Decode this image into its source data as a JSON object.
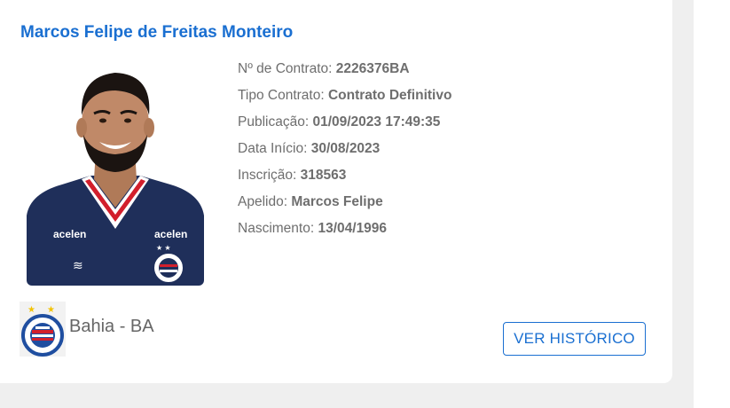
{
  "player": {
    "name": "Marcos Felipe de Freitas Monteiro",
    "photo": {
      "jersey_text_left": "acelen",
      "jersey_text_right": "acelen"
    }
  },
  "details": [
    {
      "label": "Nº de Contrato:",
      "value": "2226376BA"
    },
    {
      "label": "Tipo Contrato:",
      "value": "Contrato Definitivo"
    },
    {
      "label": "Publicação:",
      "value": "01/09/2023 17:49:35"
    },
    {
      "label": "Data Início:",
      "value": "30/08/2023"
    },
    {
      "label": "Inscrição:",
      "value": "318563"
    },
    {
      "label": "Apelido:",
      "value": "Marcos Felipe"
    },
    {
      "label": "Nascimento:",
      "value": "13/04/1996"
    }
  ],
  "club": {
    "name": "Bahia - BA",
    "logo_icon": "bahia-crest-icon"
  },
  "actions": {
    "history_label": "VER HISTÓRICO"
  },
  "colors": {
    "accent": "#1a6fd1",
    "text_muted": "#6e6e6e",
    "background": "#efefef",
    "jersey": "#1f2f5a",
    "jersey_collar_red": "#d21f2c"
  }
}
